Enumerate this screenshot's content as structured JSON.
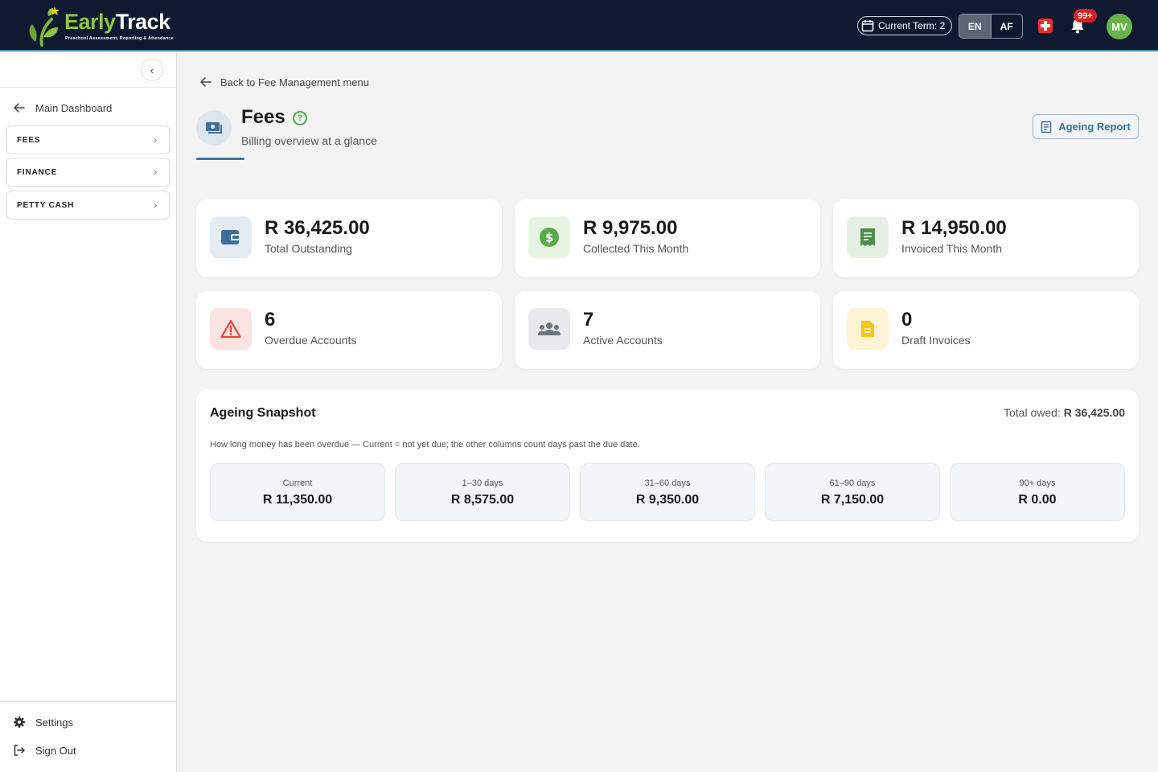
{
  "header": {
    "brand_early": "Early",
    "brand_track": "Track",
    "brand_tagline": "Preschool Assessment, Reporting & Attendance",
    "term_label": "Current Term: 2",
    "lang_en": "EN",
    "lang_af": "AF",
    "notifications_badge": "99+",
    "avatar_initials": "MV"
  },
  "sidebar": {
    "back_label": "Main Dashboard",
    "items": [
      {
        "label": "FEES"
      },
      {
        "label": "FINANCE"
      },
      {
        "label": "PETTY CASH"
      }
    ],
    "settings_label": "Settings",
    "signout_label": "Sign Out"
  },
  "main": {
    "back_link": "Back to Fee Management menu",
    "title": "Fees",
    "subtitle": "Billing overview at a glance",
    "ageing_report_button": "Ageing Report",
    "stats": [
      {
        "value": "R 36,425.00",
        "label": "Total Outstanding",
        "icon": "wallet-icon",
        "color": "#3d6f96"
      },
      {
        "value": "R 9,975.00",
        "label": "Collected This Month",
        "icon": "dollar-icon",
        "color": "#5aaa4a"
      },
      {
        "value": "R 14,950.00",
        "label": "Invoiced This Month",
        "icon": "receipt-icon",
        "color": "#4c8f4a"
      },
      {
        "value": "6",
        "label": "Overdue Accounts",
        "icon": "warning-icon",
        "color": "#e2463a"
      },
      {
        "value": "7",
        "label": "Active Accounts",
        "icon": "users-icon",
        "color": "#6b7280"
      },
      {
        "value": "0",
        "label": "Draft Invoices",
        "icon": "document-icon",
        "color": "#f5c518"
      }
    ],
    "ageing": {
      "title": "Ageing Snapshot",
      "total_label": "Total owed:",
      "total_value": "R 36,425.00",
      "description": "How long money has been overdue — Current = not yet due; the other columns count days past the due date.",
      "buckets": [
        {
          "label": "Current",
          "value": "R 11,350.00"
        },
        {
          "label": "1–30 days",
          "value": "R 8,575.00"
        },
        {
          "label": "31–60 days",
          "value": "R 9,350.00"
        },
        {
          "label": "61–90 days",
          "value": "R 7,150.00"
        },
        {
          "label": "90+ days",
          "value": "R 0.00"
        }
      ]
    }
  }
}
